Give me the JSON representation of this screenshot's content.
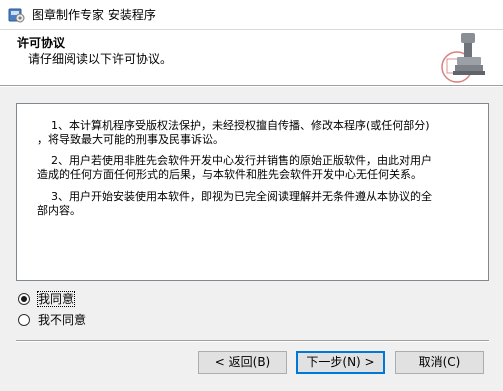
{
  "window": {
    "title": "图章制作专家 安装程序"
  },
  "header": {
    "title": "许可协议",
    "subtitle": "请仔细阅读以下许可协议。"
  },
  "license": {
    "paragraphs": [
      "    1、本计算机程序受版权法保护，未经授权擅自传播、修改本程序(或任何部分)\n，将导致最大可能的刑事及民事诉讼。",
      "    2、用户若使用非胜先会软件开发中心发行并销售的原始正版软件，由此对用户\n造成的任何方面任何形式的后果，与本软件和胜先会软件开发中心无任何关系。",
      "    3、用户开始安装使用本软件，即视为已完全阅读理解并无条件遵从本协议的全\n部内容。"
    ]
  },
  "options": {
    "agree": "我同意",
    "disagree": "我不同意",
    "selected": "agree"
  },
  "buttons": {
    "back": "< 返回(B)",
    "next": "下一步(N) >",
    "cancel": "取消(C)"
  }
}
